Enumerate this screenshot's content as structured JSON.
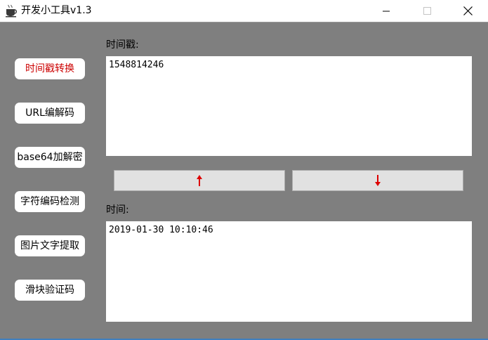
{
  "window": {
    "title": "开发小工具v1.3"
  },
  "icons": {
    "app": "coffee-cup-icon",
    "minimize": "minimize-icon",
    "maximize": "maximize-icon",
    "close": "close-icon",
    "up": "arrow-up-icon",
    "down": "arrow-down-icon"
  },
  "sidebar": {
    "items": [
      {
        "label": "时间戳转换",
        "active": true
      },
      {
        "label": "URL编解码",
        "active": false
      },
      {
        "label": "base64加解密",
        "active": false
      },
      {
        "label": "字符编码检测",
        "active": false
      },
      {
        "label": "图片文字提取",
        "active": false
      },
      {
        "label": "滑块验证码",
        "active": false
      }
    ]
  },
  "timestamp": {
    "label": "时间戳:",
    "value": "1548814246"
  },
  "datetime": {
    "label": "时间:",
    "value": "2019-01-30 10:10:46"
  },
  "colors": {
    "background": "#7f7f7f",
    "active_text": "#cc0000",
    "arrow": "#dd0000"
  }
}
